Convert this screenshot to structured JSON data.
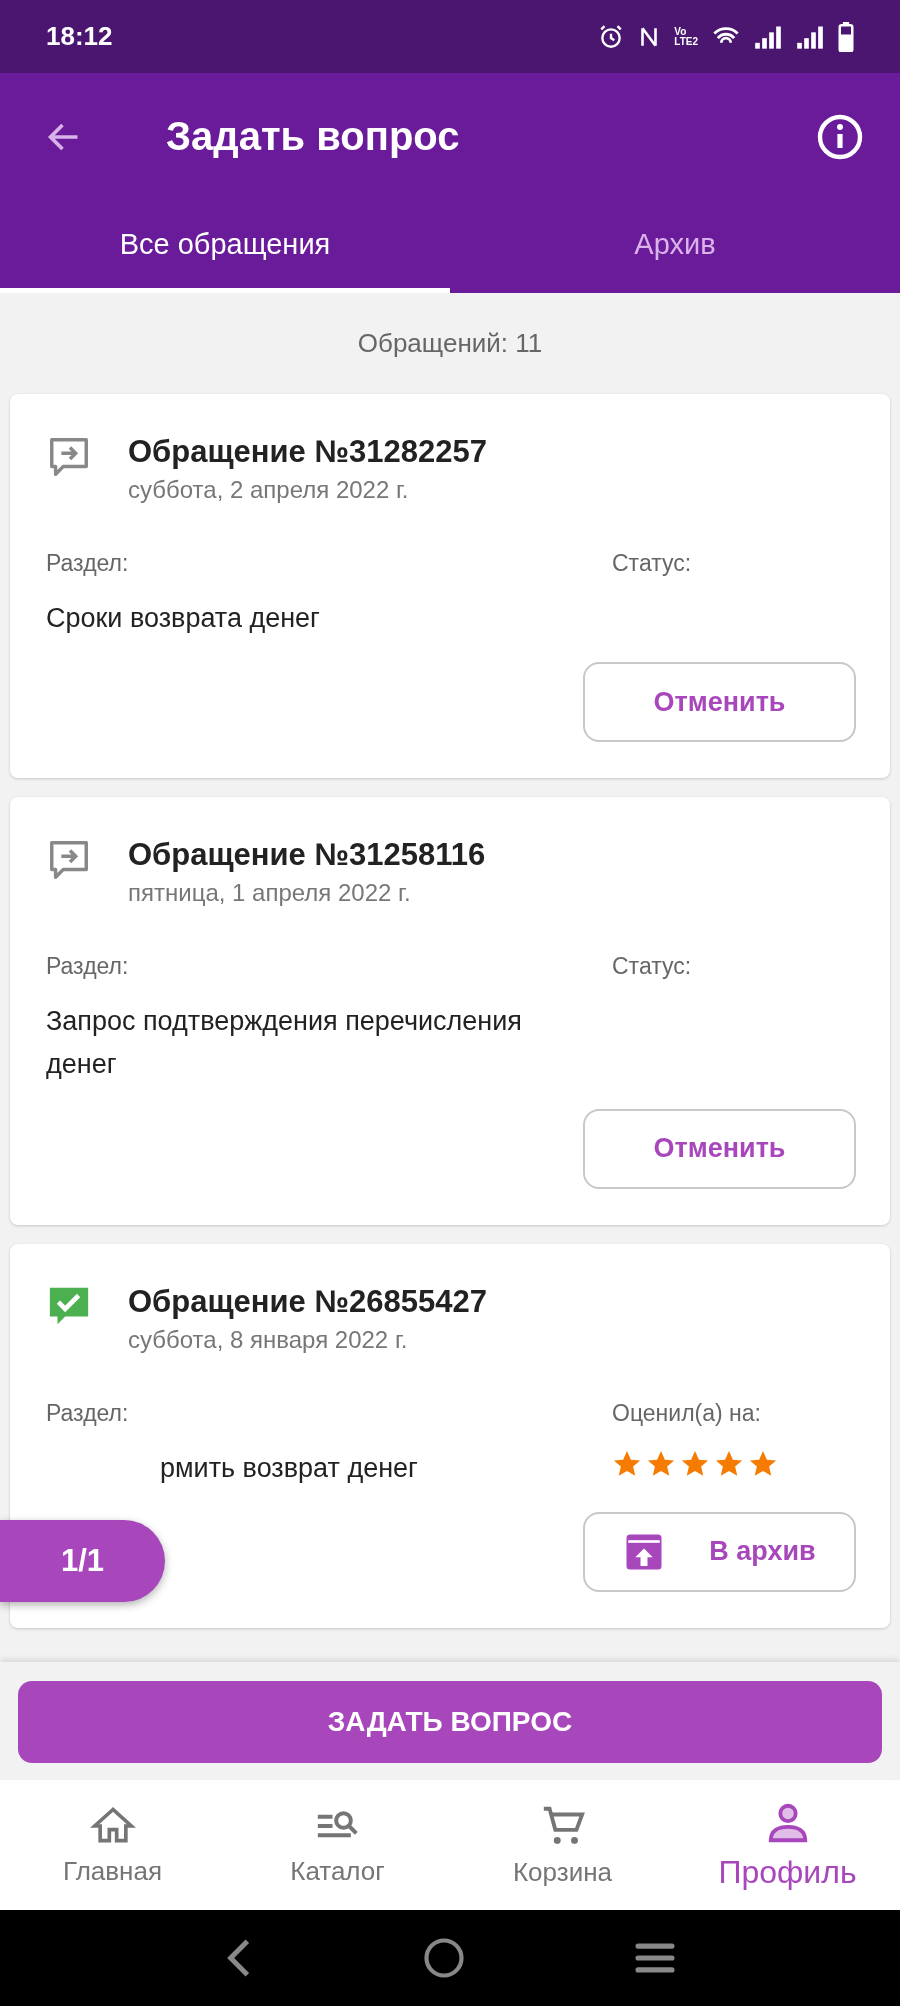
{
  "status_bar": {
    "time": "18:12",
    "network_top": "Vo",
    "network_bottom": "LTE2"
  },
  "app_bar": {
    "title": "Задать вопрос"
  },
  "tabs": [
    {
      "label": "Все обращения",
      "selected": true
    },
    {
      "label": "Архив",
      "selected": false
    }
  ],
  "count": "Обращений: 11",
  "tickets": [
    {
      "kind": "open",
      "title": "Обращение №31282257",
      "date": "суббота, 2 апреля 2022 г.",
      "section_label": "Раздел:",
      "section": "Сроки возврата денег",
      "status_label": "Статус:",
      "action": "Отменить",
      "covered": false
    },
    {
      "kind": "open",
      "title": "Обращение №31258116",
      "date": "пятница, 1 апреля 2022 г.",
      "section_label": "Раздел:",
      "section": "Запрос подтверждения перечисления денег",
      "status_label": "Статус:",
      "action": "Отменить",
      "covered": false
    },
    {
      "kind": "resolved",
      "title": "Обращение №26855427",
      "date": "суббота, 8 января 2022 г.",
      "section_label": "Раздел:",
      "section": "рмить возврат денег",
      "status_label": "Оценил(а) на:",
      "stars": 5,
      "action": "В архив",
      "covered": true
    }
  ],
  "page_indicator": "1/1",
  "ask_button": "ЗАДАТЬ ВОПРОС",
  "nav": [
    {
      "label": "Главная",
      "selected": false
    },
    {
      "label": "Каталог",
      "selected": false
    },
    {
      "label": "Корзина",
      "selected": false
    },
    {
      "label": "Профиль",
      "selected": true
    }
  ]
}
